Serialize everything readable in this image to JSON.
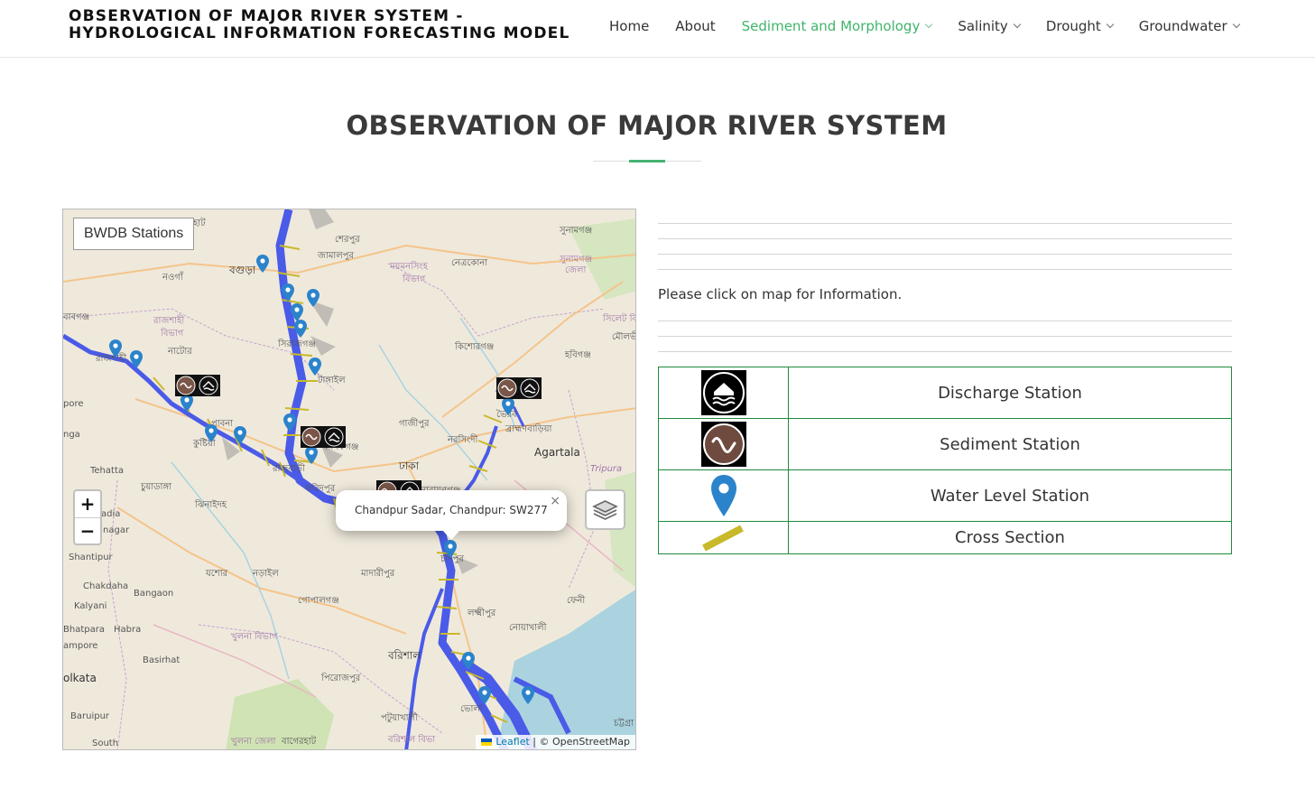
{
  "header": {
    "title_line1": "OBSERVATION OF MAJOR RIVER SYSTEM -",
    "title_line2": "HYDROLOGICAL INFORMATION FORECASTING MODEL"
  },
  "nav": {
    "items": [
      {
        "label": "Home"
      },
      {
        "label": "About"
      },
      {
        "label": "Sediment and Morphology",
        "dropdown": true,
        "active": true
      },
      {
        "label": "Salinity",
        "dropdown": true
      },
      {
        "label": "Drought",
        "dropdown": true
      },
      {
        "label": "Groundwater",
        "dropdown": true
      }
    ],
    "active_color": "#3fb46a"
  },
  "section": {
    "title": "OBSERVATION OF MAJOR RIVER SYSTEM"
  },
  "map": {
    "layer_title": "BWDB Stations",
    "zoom_in": "+",
    "zoom_out": "−",
    "popup_text": "Chandpur Sadar, Chandpur: SW277",
    "popup_close": "×",
    "attribution_leaflet": "Leaflet",
    "attribution_osm": "| © OpenStreetMap",
    "labels": {
      "l1": "হাট",
      "l2": "শেরপুর",
      "l3": "সুনামগঞ্জ",
      "l4": "বগুড়া",
      "l5": "জামালপুর",
      "l6": "ময়মনসিংহ",
      "l7": "বিভাগ",
      "l8": "নেত্রকোনা",
      "l9": "সুনামগঞ্জ",
      "l10": "জেলা",
      "l11": "নওগাঁ",
      "l12": "বাবগঞ্জ",
      "l13": "রাজশাহী",
      "l14": "বিভাগ",
      "l15": "সিলেট বি",
      "l16": "মৌলভী",
      "l17": "নাটোর",
      "l18": "সিরাজগঞ্জ",
      "l19": "কিশোরগঞ্জ",
      "l20": "হবিগঞ্জ",
      "l21": "রাজশাহী",
      "l22": "টাঙ্গাইল",
      "l23": "pore",
      "l24": "পাবনা",
      "l25": "গাজীপুর",
      "l26": "ভৈরব",
      "l27": "ব্রাহ্মণবাড়িয়া",
      "l28": "nga",
      "l29": "কুষ্টিয়া",
      "l30": "নরসিংদী",
      "l31": "Agartala",
      "l32": "Tehatta",
      "l33": "রাজবাড়ী",
      "l34": "মানিকগঞ্জ",
      "l35": "ঢাকা",
      "l36": "Tripura",
      "l37": "চুয়াডাঙ্গা",
      "l38": "নারায়ণগঞ্জ",
      "l39": "ঝিনাইদহ",
      "l40": "ফরিদপুর",
      "l41": "adia",
      "l42": "nagar",
      "l43": "Shantipur",
      "l44": "যশোর",
      "l45": "নড়াইল",
      "l46": "মাদারীপুর",
      "l47": "চাঁদপুর",
      "l48": "Chakdaha",
      "l49": "Bangaon",
      "l50": "গোপালগঞ্জ",
      "l51": "ফেনী",
      "l52": "Kalyani",
      "l53": "লক্ষ্মীপুর",
      "l54": "Bhatpara",
      "l55": "Habra",
      "l56": "খুলনা বিভাগ",
      "l57": "নোয়াখালী",
      "l58": "ampore",
      "l59": "বরিশাল",
      "l60": "Basirhat",
      "l61": "olkata",
      "l62": "পিরোজপুর",
      "l63": "ভোলা",
      "l64": "Baruipur",
      "l65": "পটুয়াখালী",
      "l66": "চট্টগ্রা",
      "l67": "South",
      "l68": "খুলনা জেলা",
      "l69": "বাগেরহাট",
      "l70": "বরিশাল বিভা"
    }
  },
  "info": {
    "message": "Please click on map for Information."
  },
  "legend": {
    "rows": [
      {
        "label": "Discharge Station",
        "icon": "discharge-station-icon"
      },
      {
        "label": "Sediment Station",
        "icon": "sediment-station-icon"
      },
      {
        "label": "Water Level Station",
        "icon": "water-level-pin-icon"
      },
      {
        "label": "Cross Section",
        "icon": "cross-section-icon"
      }
    ]
  }
}
